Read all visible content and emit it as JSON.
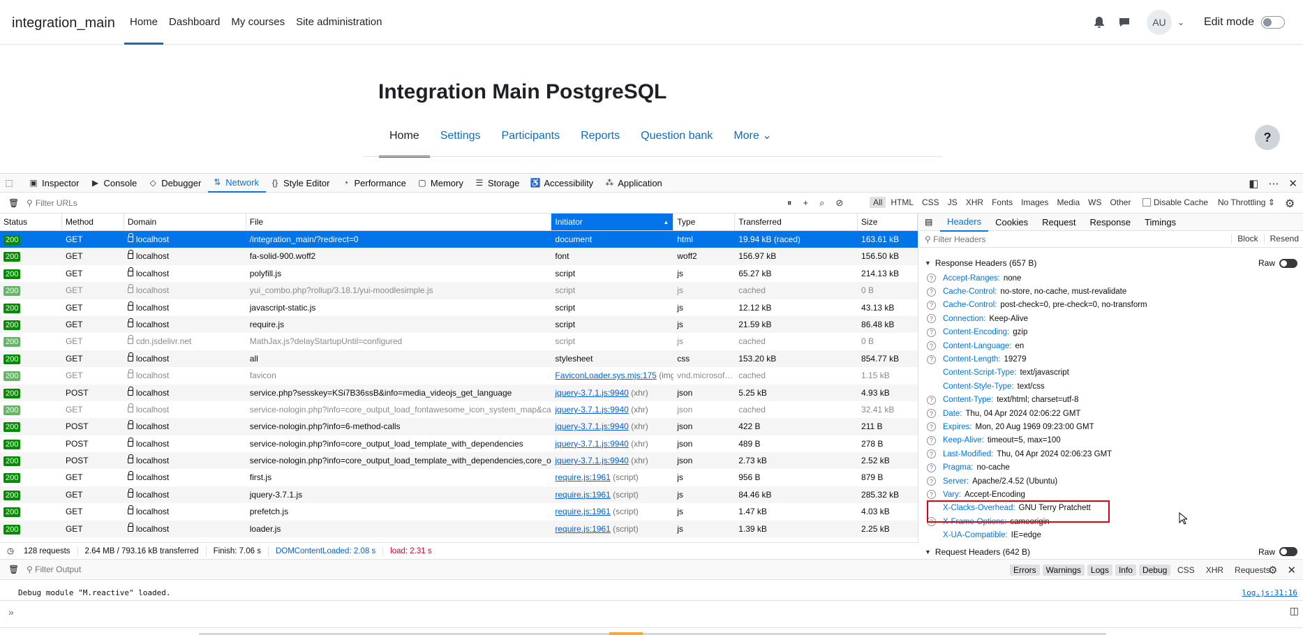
{
  "site": {
    "brand": "integration_main",
    "nav": [
      "Home",
      "Dashboard",
      "My courses",
      "Site administration"
    ],
    "avatar_initials": "AU",
    "edit_mode_label": "Edit mode"
  },
  "course": {
    "title": "Integration Main PostgreSQL",
    "nav": [
      "Home",
      "Settings",
      "Participants",
      "Reports",
      "Question bank",
      "More"
    ],
    "help_label": "?"
  },
  "devtools": {
    "tabs": [
      "Inspector",
      "Console",
      "Debugger",
      "Network",
      "Style Editor",
      "Performance",
      "Memory",
      "Storage",
      "Accessibility",
      "Application"
    ],
    "filter_placeholder": "Filter URLs",
    "type_filters": [
      "All",
      "HTML",
      "CSS",
      "JS",
      "XHR",
      "Fonts",
      "Images",
      "Media",
      "WS",
      "Other"
    ],
    "disable_cache_label": "Disable Cache",
    "throttling_label": "No Throttling ⇕",
    "columns": [
      "Status",
      "Method",
      "Domain",
      "File",
      "Initiator",
      "Type",
      "Transferred",
      "Size"
    ],
    "rows": [
      {
        "status": "200",
        "method": "GET",
        "domain": "localhost",
        "file": "/integration_main/?redirect=0",
        "initiator": "document",
        "init_link": false,
        "init_extra": "",
        "type": "html",
        "transferred": "19.94 kB (raced)",
        "size": "163.61 kB",
        "dim": false,
        "sel": true
      },
      {
        "status": "200",
        "method": "GET",
        "domain": "localhost",
        "file": "fa-solid-900.woff2",
        "initiator": "font",
        "init_link": false,
        "init_extra": "",
        "type": "woff2",
        "transferred": "156.97 kB",
        "size": "156.50 kB",
        "dim": false,
        "sel": false
      },
      {
        "status": "200",
        "method": "GET",
        "domain": "localhost",
        "file": "polyfill.js",
        "initiator": "script",
        "init_link": false,
        "init_extra": "",
        "type": "js",
        "transferred": "65.27 kB",
        "size": "214.13 kB",
        "dim": false,
        "sel": false
      },
      {
        "status": "200",
        "method": "GET",
        "domain": "localhost",
        "file": "yui_combo.php?rollup/3.18.1/yui-moodlesimple.js",
        "initiator": "script",
        "init_link": false,
        "init_extra": "",
        "type": "js",
        "transferred": "cached",
        "size": "0 B",
        "dim": true,
        "sel": false
      },
      {
        "status": "200",
        "method": "GET",
        "domain": "localhost",
        "file": "javascript-static.js",
        "initiator": "script",
        "init_link": false,
        "init_extra": "",
        "type": "js",
        "transferred": "12.12 kB",
        "size": "43.13 kB",
        "dim": false,
        "sel": false
      },
      {
        "status": "200",
        "method": "GET",
        "domain": "localhost",
        "file": "require.js",
        "initiator": "script",
        "init_link": false,
        "init_extra": "",
        "type": "js",
        "transferred": "21.59 kB",
        "size": "86.48 kB",
        "dim": false,
        "sel": false
      },
      {
        "status": "200",
        "method": "GET",
        "domain": "cdn.jsdelivr.net",
        "file": "MathJax.js?delayStartupUntil=configured",
        "initiator": "script",
        "init_link": false,
        "init_extra": "",
        "type": "js",
        "transferred": "cached",
        "size": "0 B",
        "dim": true,
        "sel": false
      },
      {
        "status": "200",
        "method": "GET",
        "domain": "localhost",
        "file": "all",
        "initiator": "stylesheet",
        "init_link": false,
        "init_extra": "",
        "type": "css",
        "transferred": "153.20 kB",
        "size": "854.77 kB",
        "dim": false,
        "sel": false
      },
      {
        "status": "200",
        "method": "GET",
        "domain": "localhost",
        "file": "favicon",
        "initiator": "FaviconLoader.sys.mjs:175",
        "init_link": true,
        "init_extra": " (img)",
        "type": "vnd.microsof…",
        "transferred": "cached",
        "size": "1.15 kB",
        "dim": true,
        "sel": false
      },
      {
        "status": "200",
        "method": "POST",
        "domain": "localhost",
        "file": "service.php?sesskey=KSi7B36ssB&info=media_videojs_get_language",
        "initiator": "jquery-3.7.1.js:9940",
        "init_link": true,
        "init_extra": " (xhr)",
        "type": "json",
        "transferred": "5.25 kB",
        "size": "4.93 kB",
        "dim": false,
        "sel": false
      },
      {
        "status": "200",
        "method": "GET",
        "domain": "localhost",
        "file": "service-nologin.php?info=core_output_load_fontawesome_icon_system_map&cachekey",
        "initiator": "jquery-3.7.1.js:9940",
        "init_link": true,
        "init_extra": " (xhr)",
        "type": "json",
        "transferred": "cached",
        "size": "32.41 kB",
        "dim": true,
        "sel": false
      },
      {
        "status": "200",
        "method": "POST",
        "domain": "localhost",
        "file": "service-nologin.php?info=6-method-calls",
        "initiator": "jquery-3.7.1.js:9940",
        "init_link": true,
        "init_extra": " (xhr)",
        "type": "json",
        "transferred": "422 B",
        "size": "211 B",
        "dim": false,
        "sel": false
      },
      {
        "status": "200",
        "method": "POST",
        "domain": "localhost",
        "file": "service-nologin.php?info=core_output_load_template_with_dependencies",
        "initiator": "jquery-3.7.1.js:9940",
        "init_link": true,
        "init_extra": " (xhr)",
        "type": "json",
        "transferred": "489 B",
        "size": "278 B",
        "dim": false,
        "sel": false
      },
      {
        "status": "200",
        "method": "POST",
        "domain": "localhost",
        "file": "service-nologin.php?info=core_output_load_template_with_dependencies,core_output",
        "initiator": "jquery-3.7.1.js:9940",
        "init_link": true,
        "init_extra": " (xhr)",
        "type": "json",
        "transferred": "2.73 kB",
        "size": "2.52 kB",
        "dim": false,
        "sel": false
      },
      {
        "status": "200",
        "method": "GET",
        "domain": "localhost",
        "file": "first.js",
        "initiator": "require.js:1961",
        "init_link": true,
        "init_extra": " (script)",
        "type": "js",
        "transferred": "956 B",
        "size": "879 B",
        "dim": false,
        "sel": false
      },
      {
        "status": "200",
        "method": "GET",
        "domain": "localhost",
        "file": "jquery-3.7.1.js",
        "initiator": "require.js:1961",
        "init_link": true,
        "init_extra": " (script)",
        "type": "js",
        "transferred": "84.46 kB",
        "size": "285.32 kB",
        "dim": false,
        "sel": false
      },
      {
        "status": "200",
        "method": "GET",
        "domain": "localhost",
        "file": "prefetch.js",
        "initiator": "require.js:1961",
        "init_link": true,
        "init_extra": " (script)",
        "type": "js",
        "transferred": "1.47 kB",
        "size": "4.03 kB",
        "dim": false,
        "sel": false
      },
      {
        "status": "200",
        "method": "GET",
        "domain": "localhost",
        "file": "loader.js",
        "initiator": "require.js:1961",
        "init_link": true,
        "init_extra": " (script)",
        "type": "js",
        "transferred": "1.39 kB",
        "size": "2.25 kB",
        "dim": false,
        "sel": false
      }
    ],
    "status_bar": {
      "requests": "128 requests",
      "transferred": "2.64 MB / 793.16 kB transferred",
      "finish": "Finish: 7.06 s",
      "dcl": "DOMContentLoaded: 2.08 s",
      "load": "load: 2.31 s"
    },
    "side_tabs": [
      "Headers",
      "Cookies",
      "Request",
      "Response",
      "Timings"
    ],
    "side_filter_placeholder": "Filter Headers",
    "block_label": "Block",
    "resend_label": "Resend",
    "response_headers_title": "Response Headers (657 B)",
    "raw_label": "Raw",
    "response_headers": [
      {
        "k": "Accept-Ranges:",
        "v": "none",
        "q": true
      },
      {
        "k": "Cache-Control:",
        "v": "no-store, no-cache, must-revalidate",
        "q": true
      },
      {
        "k": "Cache-Control:",
        "v": "post-check=0, pre-check=0, no-transform",
        "q": true
      },
      {
        "k": "Connection:",
        "v": "Keep-Alive",
        "q": true
      },
      {
        "k": "Content-Encoding:",
        "v": "gzip",
        "q": true
      },
      {
        "k": "Content-Language:",
        "v": "en",
        "q": true
      },
      {
        "k": "Content-Length:",
        "v": "19279",
        "q": true
      },
      {
        "k": "Content-Script-Type:",
        "v": "text/javascript",
        "q": false
      },
      {
        "k": "Content-Style-Type:",
        "v": "text/css",
        "q": false
      },
      {
        "k": "Content-Type:",
        "v": "text/html; charset=utf-8",
        "q": true
      },
      {
        "k": "Date:",
        "v": "Thu, 04 Apr 2024 02:06:22 GMT",
        "q": true
      },
      {
        "k": "Expires:",
        "v": "Mon, 20 Aug 1969 09:23:00 GMT",
        "q": true
      },
      {
        "k": "Keep-Alive:",
        "v": "timeout=5, max=100",
        "q": true
      },
      {
        "k": "Last-Modified:",
        "v": "Thu, 04 Apr 2024 02:06:23 GMT",
        "q": true
      },
      {
        "k": "Pragma:",
        "v": "no-cache",
        "q": true
      },
      {
        "k": "Server:",
        "v": "Apache/2.4.52 (Ubuntu)",
        "q": true
      },
      {
        "k": "Vary:",
        "v": "Accept-Encoding",
        "q": true
      },
      {
        "k": "X-Clacks-Overhead:",
        "v": "GNU Terry Pratchett",
        "q": false
      },
      {
        "k": "X-Frame-Options:",
        "v": "sameorigin",
        "q": true
      },
      {
        "k": "X-UA-Compatible:",
        "v": "IE=edge",
        "q": false
      }
    ],
    "request_headers_title": "Request Headers (642 B)",
    "console": {
      "filter_placeholder": "Filter Output",
      "levels": [
        "Errors",
        "Warnings",
        "Logs",
        "Info",
        "Debug"
      ],
      "extra": [
        "CSS",
        "XHR",
        "Requests"
      ],
      "message": "Debug module \"M.reactive\" loaded.",
      "message_source": "log.js:31:16"
    }
  }
}
